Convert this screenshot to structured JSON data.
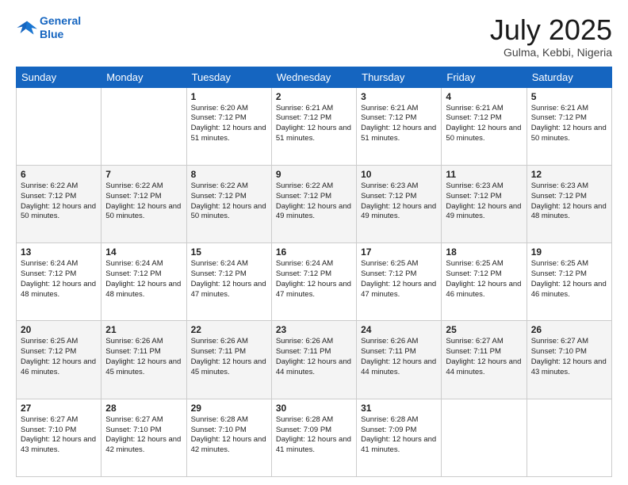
{
  "header": {
    "logo_line1": "General",
    "logo_line2": "Blue",
    "month": "July 2025",
    "location": "Gulma, Kebbi, Nigeria"
  },
  "days_of_week": [
    "Sunday",
    "Monday",
    "Tuesday",
    "Wednesday",
    "Thursday",
    "Friday",
    "Saturday"
  ],
  "weeks": [
    [
      {
        "day": "",
        "info": ""
      },
      {
        "day": "",
        "info": ""
      },
      {
        "day": "1",
        "info": "Sunrise: 6:20 AM\nSunset: 7:12 PM\nDaylight: 12 hours and 51 minutes."
      },
      {
        "day": "2",
        "info": "Sunrise: 6:21 AM\nSunset: 7:12 PM\nDaylight: 12 hours and 51 minutes."
      },
      {
        "day": "3",
        "info": "Sunrise: 6:21 AM\nSunset: 7:12 PM\nDaylight: 12 hours and 51 minutes."
      },
      {
        "day": "4",
        "info": "Sunrise: 6:21 AM\nSunset: 7:12 PM\nDaylight: 12 hours and 50 minutes."
      },
      {
        "day": "5",
        "info": "Sunrise: 6:21 AM\nSunset: 7:12 PM\nDaylight: 12 hours and 50 minutes."
      }
    ],
    [
      {
        "day": "6",
        "info": "Sunrise: 6:22 AM\nSunset: 7:12 PM\nDaylight: 12 hours and 50 minutes."
      },
      {
        "day": "7",
        "info": "Sunrise: 6:22 AM\nSunset: 7:12 PM\nDaylight: 12 hours and 50 minutes."
      },
      {
        "day": "8",
        "info": "Sunrise: 6:22 AM\nSunset: 7:12 PM\nDaylight: 12 hours and 50 minutes."
      },
      {
        "day": "9",
        "info": "Sunrise: 6:22 AM\nSunset: 7:12 PM\nDaylight: 12 hours and 49 minutes."
      },
      {
        "day": "10",
        "info": "Sunrise: 6:23 AM\nSunset: 7:12 PM\nDaylight: 12 hours and 49 minutes."
      },
      {
        "day": "11",
        "info": "Sunrise: 6:23 AM\nSunset: 7:12 PM\nDaylight: 12 hours and 49 minutes."
      },
      {
        "day": "12",
        "info": "Sunrise: 6:23 AM\nSunset: 7:12 PM\nDaylight: 12 hours and 48 minutes."
      }
    ],
    [
      {
        "day": "13",
        "info": "Sunrise: 6:24 AM\nSunset: 7:12 PM\nDaylight: 12 hours and 48 minutes."
      },
      {
        "day": "14",
        "info": "Sunrise: 6:24 AM\nSunset: 7:12 PM\nDaylight: 12 hours and 48 minutes."
      },
      {
        "day": "15",
        "info": "Sunrise: 6:24 AM\nSunset: 7:12 PM\nDaylight: 12 hours and 47 minutes."
      },
      {
        "day": "16",
        "info": "Sunrise: 6:24 AM\nSunset: 7:12 PM\nDaylight: 12 hours and 47 minutes."
      },
      {
        "day": "17",
        "info": "Sunrise: 6:25 AM\nSunset: 7:12 PM\nDaylight: 12 hours and 47 minutes."
      },
      {
        "day": "18",
        "info": "Sunrise: 6:25 AM\nSunset: 7:12 PM\nDaylight: 12 hours and 46 minutes."
      },
      {
        "day": "19",
        "info": "Sunrise: 6:25 AM\nSunset: 7:12 PM\nDaylight: 12 hours and 46 minutes."
      }
    ],
    [
      {
        "day": "20",
        "info": "Sunrise: 6:25 AM\nSunset: 7:12 PM\nDaylight: 12 hours and 46 minutes."
      },
      {
        "day": "21",
        "info": "Sunrise: 6:26 AM\nSunset: 7:11 PM\nDaylight: 12 hours and 45 minutes."
      },
      {
        "day": "22",
        "info": "Sunrise: 6:26 AM\nSunset: 7:11 PM\nDaylight: 12 hours and 45 minutes."
      },
      {
        "day": "23",
        "info": "Sunrise: 6:26 AM\nSunset: 7:11 PM\nDaylight: 12 hours and 44 minutes."
      },
      {
        "day": "24",
        "info": "Sunrise: 6:26 AM\nSunset: 7:11 PM\nDaylight: 12 hours and 44 minutes."
      },
      {
        "day": "25",
        "info": "Sunrise: 6:27 AM\nSunset: 7:11 PM\nDaylight: 12 hours and 44 minutes."
      },
      {
        "day": "26",
        "info": "Sunrise: 6:27 AM\nSunset: 7:10 PM\nDaylight: 12 hours and 43 minutes."
      }
    ],
    [
      {
        "day": "27",
        "info": "Sunrise: 6:27 AM\nSunset: 7:10 PM\nDaylight: 12 hours and 43 minutes."
      },
      {
        "day": "28",
        "info": "Sunrise: 6:27 AM\nSunset: 7:10 PM\nDaylight: 12 hours and 42 minutes."
      },
      {
        "day": "29",
        "info": "Sunrise: 6:28 AM\nSunset: 7:10 PM\nDaylight: 12 hours and 42 minutes."
      },
      {
        "day": "30",
        "info": "Sunrise: 6:28 AM\nSunset: 7:09 PM\nDaylight: 12 hours and 41 minutes."
      },
      {
        "day": "31",
        "info": "Sunrise: 6:28 AM\nSunset: 7:09 PM\nDaylight: 12 hours and 41 minutes."
      },
      {
        "day": "",
        "info": ""
      },
      {
        "day": "",
        "info": ""
      }
    ]
  ]
}
